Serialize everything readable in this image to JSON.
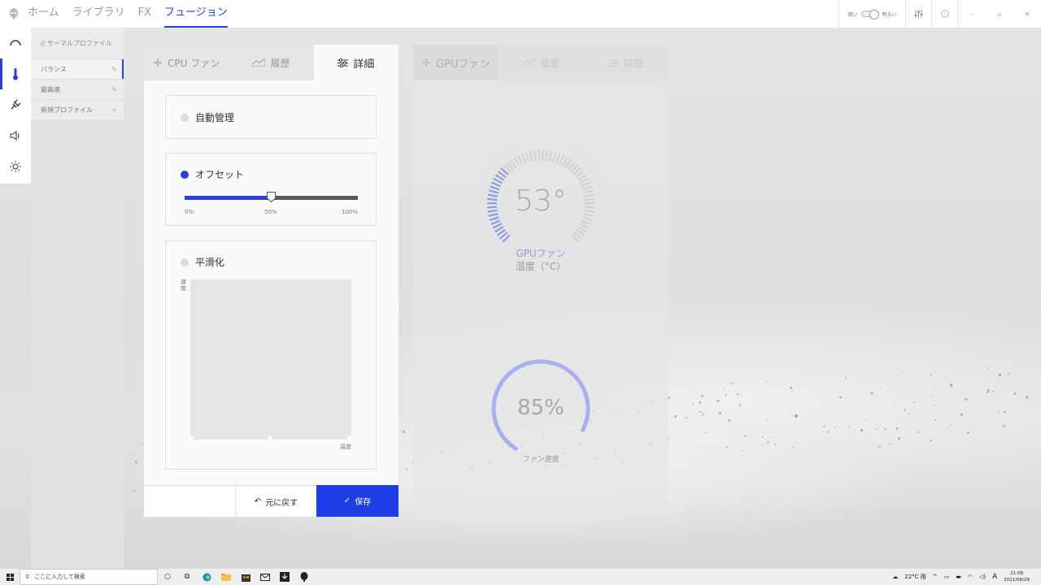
{
  "topnav": {
    "items": [
      {
        "label": "ホーム"
      },
      {
        "label": "ライブラリ"
      },
      {
        "label": "FX"
      },
      {
        "label": "フュージョン"
      }
    ],
    "brightness_dark": "暗い",
    "brightness_light": "明るい"
  },
  "profiles": {
    "header": "// サーマルプロファイル",
    "items": [
      {
        "label": "バランス"
      },
      {
        "label": "最高速"
      },
      {
        "label": "新規プロファイル"
      }
    ]
  },
  "cpu_panel": {
    "tabs": [
      {
        "label": "CPU ファン"
      },
      {
        "label": "履歴"
      },
      {
        "label": "詳細"
      }
    ],
    "auto_label": "自動管理",
    "offset_label": "オフセット",
    "slider": {
      "value_percent": 50,
      "min_label": "0%",
      "mid_label": "50%",
      "max_label": "100%"
    },
    "smoothing_label": "平滑化",
    "graph_ylabel": "速度",
    "graph_xlabel": "温度",
    "revert_label": "元に戻す",
    "save_label": "保存"
  },
  "gpu_panel": {
    "tabs": [
      {
        "label": "GPUファン"
      },
      {
        "label": "履歴"
      },
      {
        "label": "詳細"
      }
    ],
    "temperature_value": "53°",
    "temperature_source": "GPUファン",
    "temperature_label": "温度（°C）",
    "fan_speed_value": "85%",
    "fan_speed_label": "ファン速度"
  },
  "taskbar": {
    "search_placeholder": "ここに入力して検索",
    "weather": "22°C 雨",
    "ime": "A",
    "time": "21:08",
    "date": "2021/06/29"
  },
  "colors": {
    "accent": "#2a3fd8",
    "save": "#1f3de6",
    "gauge": "#8f9ae8"
  }
}
